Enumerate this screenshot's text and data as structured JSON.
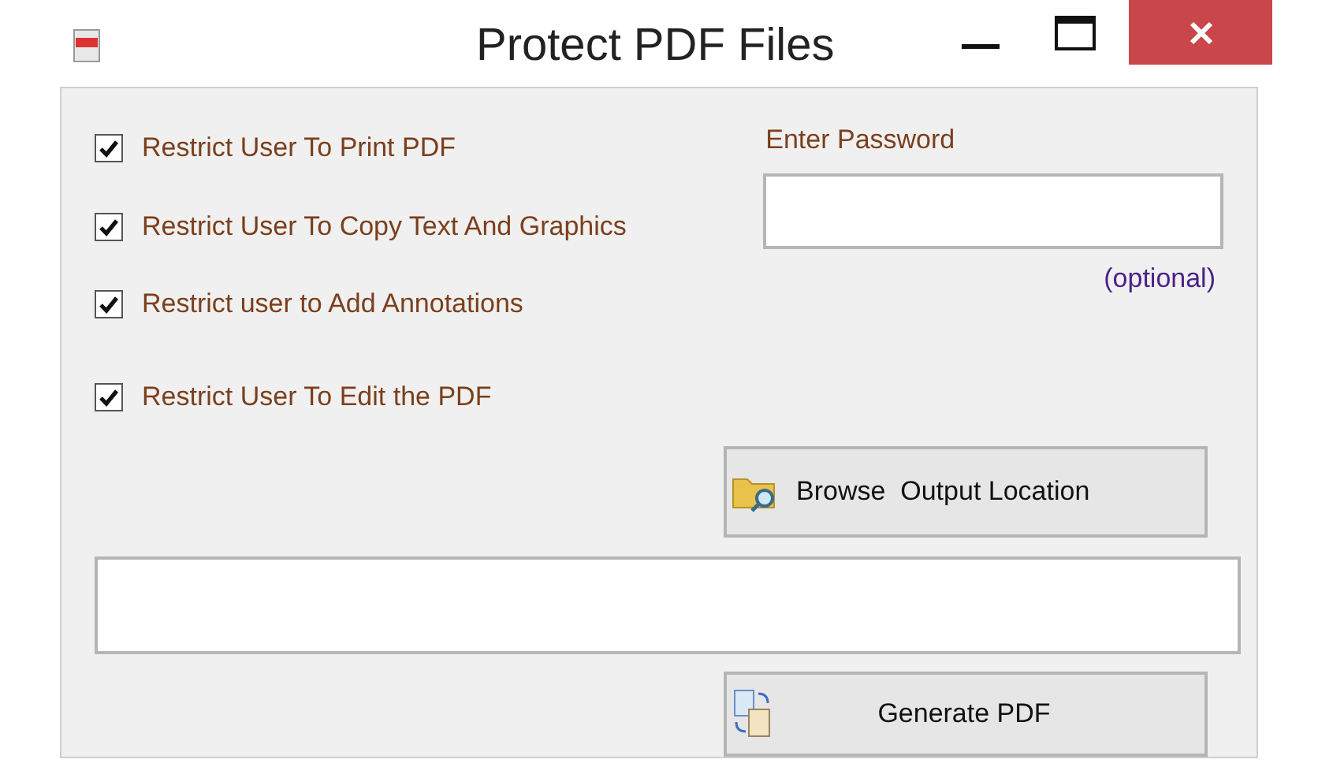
{
  "window": {
    "title": "Protect PDF Files"
  },
  "options": [
    {
      "label": "Restrict User To Print PDF",
      "checked": true
    },
    {
      "label": "Restrict User To Copy Text And Graphics",
      "checked": true
    },
    {
      "label": "Restrict user to Add Annotations",
      "checked": true
    },
    {
      "label": "Restrict User To Edit the PDF",
      "checked": true
    }
  ],
  "password": {
    "label": "Enter Password",
    "hint": "(optional)"
  },
  "browse_button": "Browse  Output Location",
  "generate_button": "Generate PDF"
}
